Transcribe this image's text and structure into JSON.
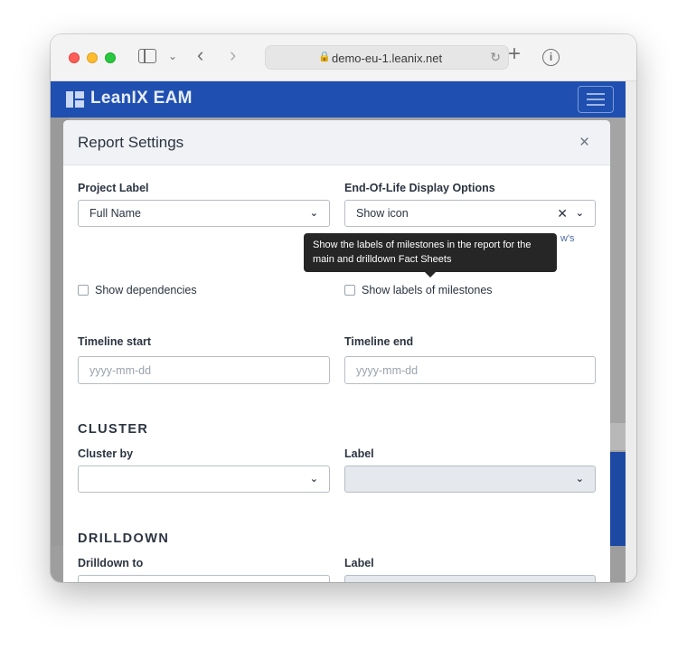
{
  "browser": {
    "url": "demo-eu-1.leanix.net"
  },
  "app": {
    "logo_text": "LeanIX EAM"
  },
  "modal": {
    "title": "Report Settings",
    "close_glyph": "×",
    "project_label": {
      "label": "Project Label",
      "value": "Full Name"
    },
    "eol_display": {
      "label": "End-Of-Life Display Options",
      "value": "Show icon",
      "partial_link_text": "w's"
    },
    "tooltip": "Show the labels of milestones in the report for the main and drilldown Fact Sheets",
    "show_dependencies": "Show dependencies",
    "show_milestone_labels": "Show labels of milestones",
    "timeline_start": {
      "label": "Timeline start",
      "placeholder": "yyyy-mm-dd"
    },
    "timeline_end": {
      "label": "Timeline end",
      "placeholder": "yyyy-mm-dd"
    },
    "cluster": {
      "title": "CLUSTER",
      "cluster_by_label": "Cluster by",
      "label_label": "Label"
    },
    "drilldown": {
      "title": "DRILLDOWN",
      "drilldown_to_label": "Drilldown to",
      "label_label": "Label"
    }
  },
  "icons": {
    "chevron": "⌄",
    "clear": "✕"
  },
  "colors": {
    "app_bar": "#1f4fb0",
    "tooltip_bg": "#262626"
  }
}
